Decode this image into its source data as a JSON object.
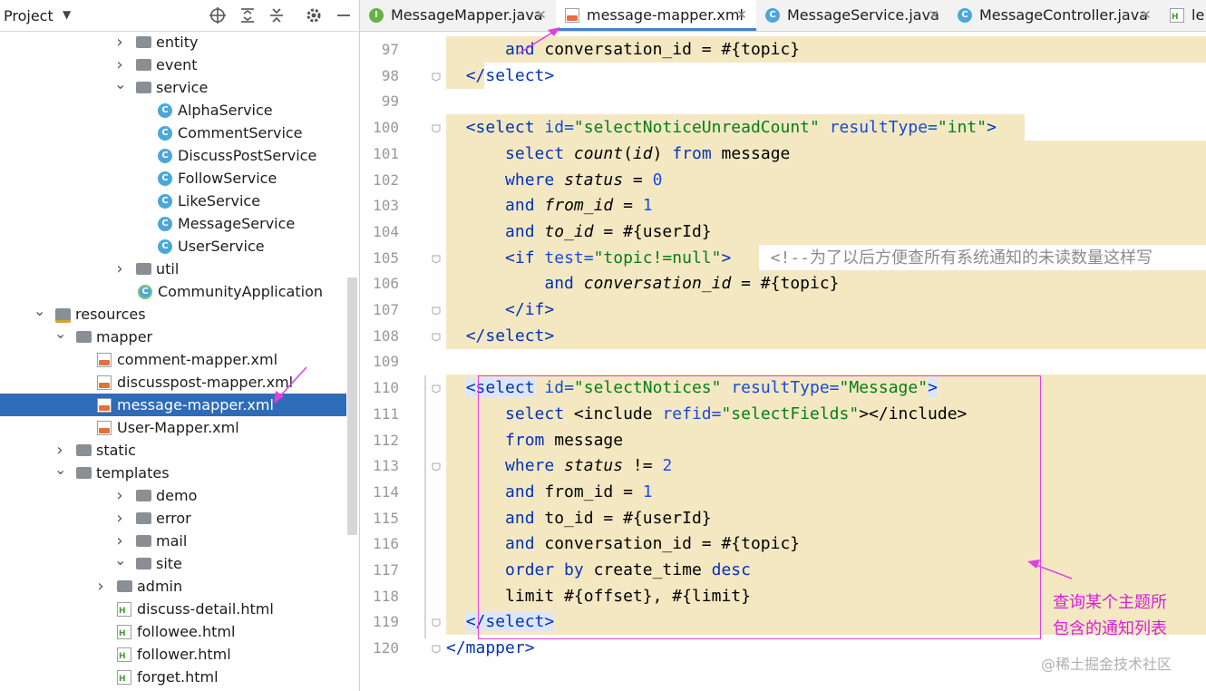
{
  "project_panel": {
    "title": "Project",
    "tree": [
      {
        "label": "entity",
        "kind": "folder",
        "depth": 2,
        "expanded": false
      },
      {
        "label": "event",
        "kind": "folder",
        "depth": 2,
        "expanded": false
      },
      {
        "label": "service",
        "kind": "folder",
        "depth": 2,
        "expanded": true
      },
      {
        "label": "AlphaService",
        "kind": "class",
        "depth": 3
      },
      {
        "label": "CommentService",
        "kind": "class",
        "depth": 3
      },
      {
        "label": "DiscussPostService",
        "kind": "class",
        "depth": 3
      },
      {
        "label": "FollowService",
        "kind": "class",
        "depth": 3
      },
      {
        "label": "LikeService",
        "kind": "class",
        "depth": 3
      },
      {
        "label": "MessageService",
        "kind": "class",
        "depth": 3
      },
      {
        "label": "UserService",
        "kind": "class",
        "depth": 3
      },
      {
        "label": "util",
        "kind": "folder",
        "depth": 2,
        "expanded": false
      },
      {
        "label": "CommunityApplication",
        "kind": "app",
        "depth": 2
      },
      {
        "label": "resources",
        "kind": "resfolder",
        "depth": 0,
        "expanded": true
      },
      {
        "label": "mapper",
        "kind": "folder",
        "depth": 1,
        "expanded": true
      },
      {
        "label": "comment-mapper.xml",
        "kind": "xml",
        "depth": 2
      },
      {
        "label": "discusspost-mapper.xml",
        "kind": "xml",
        "depth": 2
      },
      {
        "label": "message-mapper.xml",
        "kind": "xml",
        "depth": 2,
        "selected": true
      },
      {
        "label": "User-Mapper.xml",
        "kind": "xml",
        "depth": 2
      },
      {
        "label": "static",
        "kind": "folder",
        "depth": 1,
        "expanded": false
      },
      {
        "label": "templates",
        "kind": "folder",
        "depth": 1,
        "expanded": true
      },
      {
        "label": "demo",
        "kind": "folder",
        "depth": 2,
        "expanded": false
      },
      {
        "label": "error",
        "kind": "folder",
        "depth": 2,
        "expanded": false
      },
      {
        "label": "mail",
        "kind": "folder",
        "depth": 2,
        "expanded": false
      },
      {
        "label": "site",
        "kind": "folder",
        "depth": 2,
        "expanded": true
      },
      {
        "label": "admin",
        "kind": "folder",
        "depth": 3,
        "expanded": false
      },
      {
        "label": "discuss-detail.html",
        "kind": "html",
        "depth": 3
      },
      {
        "label": "followee.html",
        "kind": "html",
        "depth": 3
      },
      {
        "label": "follower.html",
        "kind": "html",
        "depth": 3
      },
      {
        "label": "forget.html",
        "kind": "html",
        "depth": 3
      }
    ]
  },
  "tabs": [
    {
      "label": "MessageMapper.java",
      "icon": "interface-icon",
      "active": false
    },
    {
      "label": "message-mapper.xml",
      "icon": "xml-file-icon",
      "active": true
    },
    {
      "label": "MessageService.java",
      "icon": "class-icon",
      "active": false
    },
    {
      "label": "MessageController.java",
      "icon": "class-icon",
      "active": false
    },
    {
      "label": "le",
      "icon": "html-file-icon",
      "active": false
    }
  ],
  "editor": {
    "lines": [
      {
        "num": "97",
        "code": [
          [
            "      ",
            ""
          ],
          [
            "and",
            "kw"
          ],
          [
            " conversation_id = #{topic}",
            ""
          ]
        ],
        "hl": [
          95,
          933
        ]
      },
      {
        "num": "98",
        "code": [
          [
            "  ",
            ""
          ],
          [
            "</select>",
            "tag"
          ]
        ],
        "hl": [
          95,
          137
        ]
      },
      {
        "num": "99",
        "code": [],
        "hl": null
      },
      {
        "num": "100",
        "code": [
          [
            "  ",
            ""
          ],
          [
            "<select",
            "tag"
          ],
          [
            " ",
            ""
          ],
          [
            "id=",
            "attr"
          ],
          [
            "\"selectNoticeUnreadCount\"",
            "str"
          ],
          [
            " ",
            ""
          ],
          [
            "resultType=",
            "attr"
          ],
          [
            "\"int\"",
            "str"
          ],
          [
            ">",
            "tag"
          ]
        ],
        "hl": [
          95,
          733
        ]
      },
      {
        "num": "101",
        "code": [
          [
            "      ",
            ""
          ],
          [
            "select",
            "kw"
          ],
          [
            " ",
            ""
          ],
          [
            "count",
            "it"
          ],
          [
            "(",
            ""
          ],
          [
            "id",
            "it"
          ],
          [
            ") ",
            ""
          ],
          [
            "from",
            "kw"
          ],
          [
            " message",
            ""
          ]
        ],
        "hl": [
          95,
          933
        ]
      },
      {
        "num": "102",
        "code": [
          [
            "      ",
            ""
          ],
          [
            "where",
            "kw"
          ],
          [
            " ",
            ""
          ],
          [
            "status",
            "it"
          ],
          [
            " = ",
            ""
          ],
          [
            "0",
            "num"
          ]
        ],
        "hl": [
          95,
          933
        ]
      },
      {
        "num": "103",
        "code": [
          [
            "      ",
            ""
          ],
          [
            "and",
            "kw"
          ],
          [
            " ",
            ""
          ],
          [
            "from_id",
            "it"
          ],
          [
            " = ",
            ""
          ],
          [
            "1",
            "num"
          ]
        ],
        "hl": [
          95,
          933
        ]
      },
      {
        "num": "104",
        "code": [
          [
            "      ",
            ""
          ],
          [
            "and",
            "kw"
          ],
          [
            " ",
            ""
          ],
          [
            "to_id",
            "it"
          ],
          [
            " = #{userId}",
            ""
          ]
        ],
        "hl": [
          95,
          933
        ]
      },
      {
        "num": "105",
        "code": [
          [
            "      ",
            ""
          ],
          [
            "<if",
            "tag"
          ],
          [
            " ",
            ""
          ],
          [
            "test=",
            "attr"
          ],
          [
            "\"topic!=null\"",
            "str"
          ],
          [
            ">",
            "tag"
          ],
          [
            "    ",
            ""
          ],
          [
            "<!--为了以后方便查所有系统通知的未读数量这样写",
            "com"
          ]
        ],
        "hl": [
          95,
          440
        ]
      },
      {
        "num": "106",
        "code": [
          [
            "          ",
            ""
          ],
          [
            "and",
            "kw"
          ],
          [
            " ",
            ""
          ],
          [
            "conversation_id",
            "it"
          ],
          [
            " = #{topic}",
            ""
          ]
        ],
        "hl": [
          95,
          933
        ]
      },
      {
        "num": "107",
        "code": [
          [
            "      ",
            ""
          ],
          [
            "</if>",
            "tag"
          ]
        ],
        "hl": [
          95,
          933
        ]
      },
      {
        "num": "108",
        "code": [
          [
            "  ",
            ""
          ],
          [
            "</select>",
            "tag"
          ]
        ],
        "hl": [
          95,
          933
        ]
      },
      {
        "num": "109",
        "code": [],
        "hl": null
      },
      {
        "num": "110",
        "code": [
          [
            "  ",
            ""
          ],
          [
            "<select",
            "tag"
          ],
          [
            " ",
            ""
          ],
          [
            "id=",
            "attr"
          ],
          [
            "\"selectNotices\"",
            "str"
          ],
          [
            " ",
            ""
          ],
          [
            "resultType=",
            "attr"
          ],
          [
            "\"Message\"",
            "str"
          ],
          [
            ">",
            "tag"
          ]
        ],
        "hl": [
          95,
          933
        ]
      },
      {
        "num": "111",
        "code": [
          [
            "      ",
            ""
          ],
          [
            "select",
            "kw"
          ],
          [
            " <include ",
            ""
          ],
          [
            "refid=",
            "attr"
          ],
          [
            "\"selectFields\"",
            "str"
          ],
          [
            "></include>",
            ""
          ]
        ],
        "hl": [
          95,
          933
        ]
      },
      {
        "num": "112",
        "code": [
          [
            "      ",
            ""
          ],
          [
            "from",
            "kw"
          ],
          [
            " message",
            ""
          ]
        ],
        "hl": [
          95,
          933
        ]
      },
      {
        "num": "113",
        "code": [
          [
            "      ",
            ""
          ],
          [
            "where",
            "kw"
          ],
          [
            " ",
            ""
          ],
          [
            "status",
            "it"
          ],
          [
            " != ",
            ""
          ],
          [
            "2",
            "num"
          ]
        ],
        "hl": [
          95,
          933
        ]
      },
      {
        "num": "114",
        "code": [
          [
            "      ",
            ""
          ],
          [
            "and",
            "kw"
          ],
          [
            " from_id = ",
            ""
          ],
          [
            "1",
            "num"
          ]
        ],
        "hl": [
          95,
          933
        ]
      },
      {
        "num": "115",
        "code": [
          [
            "      ",
            ""
          ],
          [
            "and",
            "kw"
          ],
          [
            " to_id = #{userId}",
            ""
          ]
        ],
        "hl": [
          95,
          933
        ]
      },
      {
        "num": "116",
        "code": [
          [
            "      ",
            ""
          ],
          [
            "and",
            "kw"
          ],
          [
            " conversation_id = #{topic}",
            ""
          ]
        ],
        "hl": [
          95,
          933
        ]
      },
      {
        "num": "117",
        "code": [
          [
            "      ",
            ""
          ],
          [
            "order by",
            "kw"
          ],
          [
            " create_time ",
            ""
          ],
          [
            "desc",
            "kw"
          ]
        ],
        "hl": [
          95,
          933
        ]
      },
      {
        "num": "118",
        "code": [
          [
            "      ",
            ""
          ],
          [
            "limit #{offset}, #{limit}",
            ""
          ]
        ],
        "hl": [
          95,
          933
        ]
      },
      {
        "num": "119",
        "code": [
          [
            "  ",
            ""
          ],
          [
            "</select>",
            "tag"
          ]
        ],
        "hl": [
          95,
          933
        ]
      },
      {
        "num": "120",
        "code": [
          [
            "</mapper>",
            "tag"
          ]
        ],
        "hl": null
      }
    ]
  },
  "annotation": {
    "line1": "查询某个主题所",
    "line2": "包含的通知列表",
    "color": "#d81fd8"
  },
  "watermark": "@稀土掘金技术社区"
}
